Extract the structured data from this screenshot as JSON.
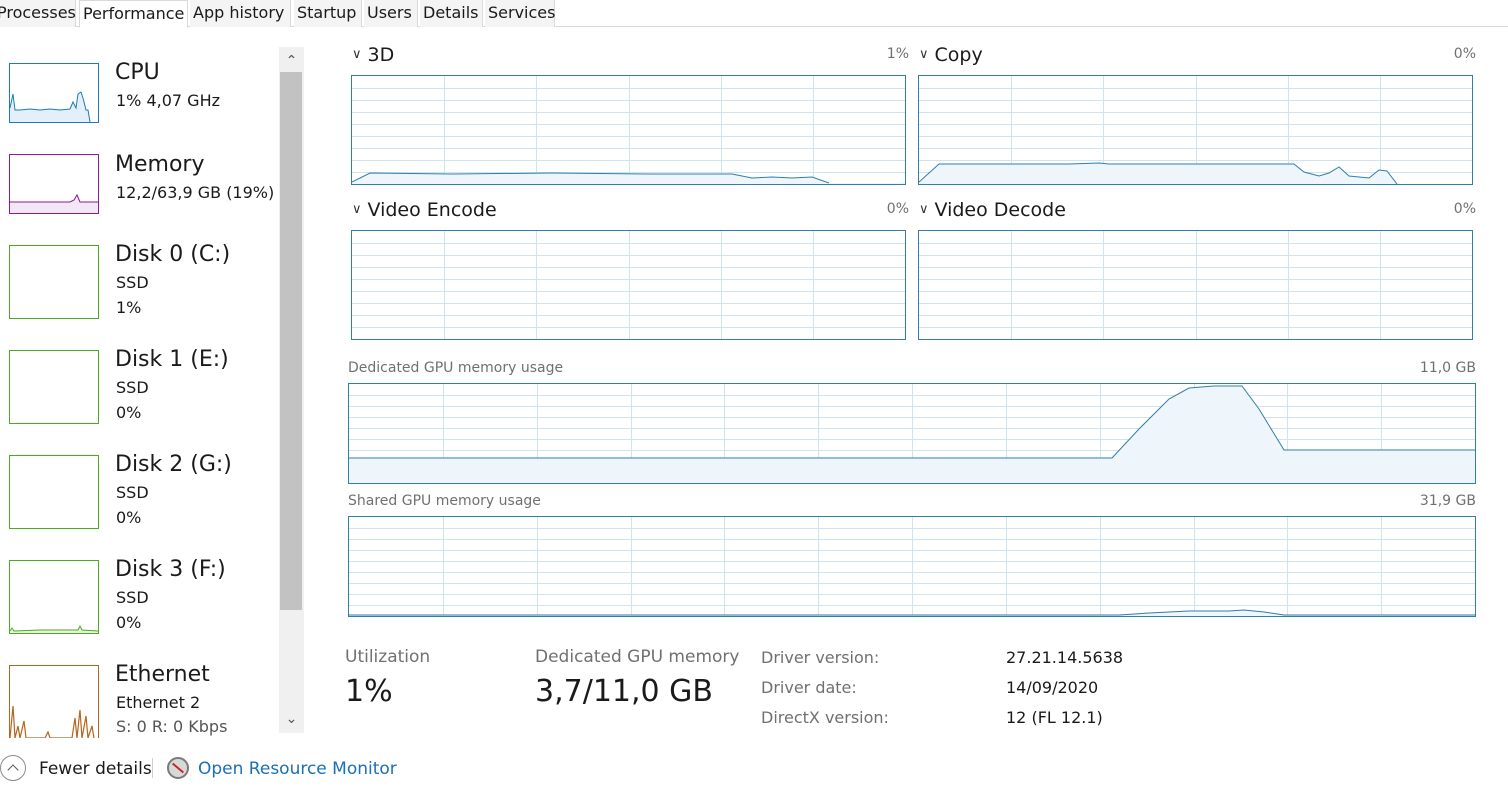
{
  "tabs": [
    "Processes",
    "Performance",
    "App history",
    "Startup",
    "Users",
    "Details",
    "Services"
  ],
  "sidebar": {
    "items": [
      {
        "name": "CPU",
        "lines": [
          "1%  4,07 GHz"
        ],
        "color": "#1e7bb5"
      },
      {
        "name": "Memory",
        "lines": [
          "12,2/63,9 GB (19%)"
        ],
        "color": "#8b1a96"
      },
      {
        "name": "Disk 0 (C:)",
        "lines": [
          "SSD",
          "1%"
        ],
        "color": "#4caa1e"
      },
      {
        "name": "Disk 1 (E:)",
        "lines": [
          "SSD",
          "0%"
        ],
        "color": "#4caa1e"
      },
      {
        "name": "Disk 2 (G:)",
        "lines": [
          "SSD",
          "0%"
        ],
        "color": "#4caa1e"
      },
      {
        "name": "Disk 3 (F:)",
        "lines": [
          "SSD",
          "0%"
        ],
        "color": "#4caa1e"
      },
      {
        "name": "Ethernet",
        "lines": [
          "Ethernet 2",
          "S: 0  R: 0 Kbps"
        ],
        "color": "#b5651d"
      }
    ]
  },
  "engines": [
    {
      "title": "3D",
      "percent": "1%"
    },
    {
      "title": "Copy",
      "percent": "0%"
    },
    {
      "title": "Video Encode",
      "percent": "0%"
    },
    {
      "title": "Video Decode",
      "percent": "0%"
    }
  ],
  "memory_graphs": {
    "dedicated": {
      "label": "Dedicated GPU memory usage",
      "max": "11,0 GB"
    },
    "shared": {
      "label": "Shared GPU memory usage",
      "max": "31,9 GB"
    }
  },
  "stats": {
    "utilization": {
      "label": "Utilization",
      "value": "1%"
    },
    "dedicated": {
      "label": "Dedicated GPU memory",
      "value": "3,7/11,0 GB"
    }
  },
  "details": [
    {
      "label": "Driver version:",
      "value": "27.21.14.5638"
    },
    {
      "label": "Driver date:",
      "value": "14/09/2020"
    },
    {
      "label": "DirectX version:",
      "value": "12 (FL 12.1)"
    }
  ],
  "footer": {
    "fewer_details": "Fewer details",
    "open_resource_monitor": "Open Resource Monitor"
  },
  "colors": {
    "accent": "#2f7fa8",
    "grid": "#cfe4ef",
    "fill": "#eef5fb",
    "link": "#1a6fb6"
  }
}
